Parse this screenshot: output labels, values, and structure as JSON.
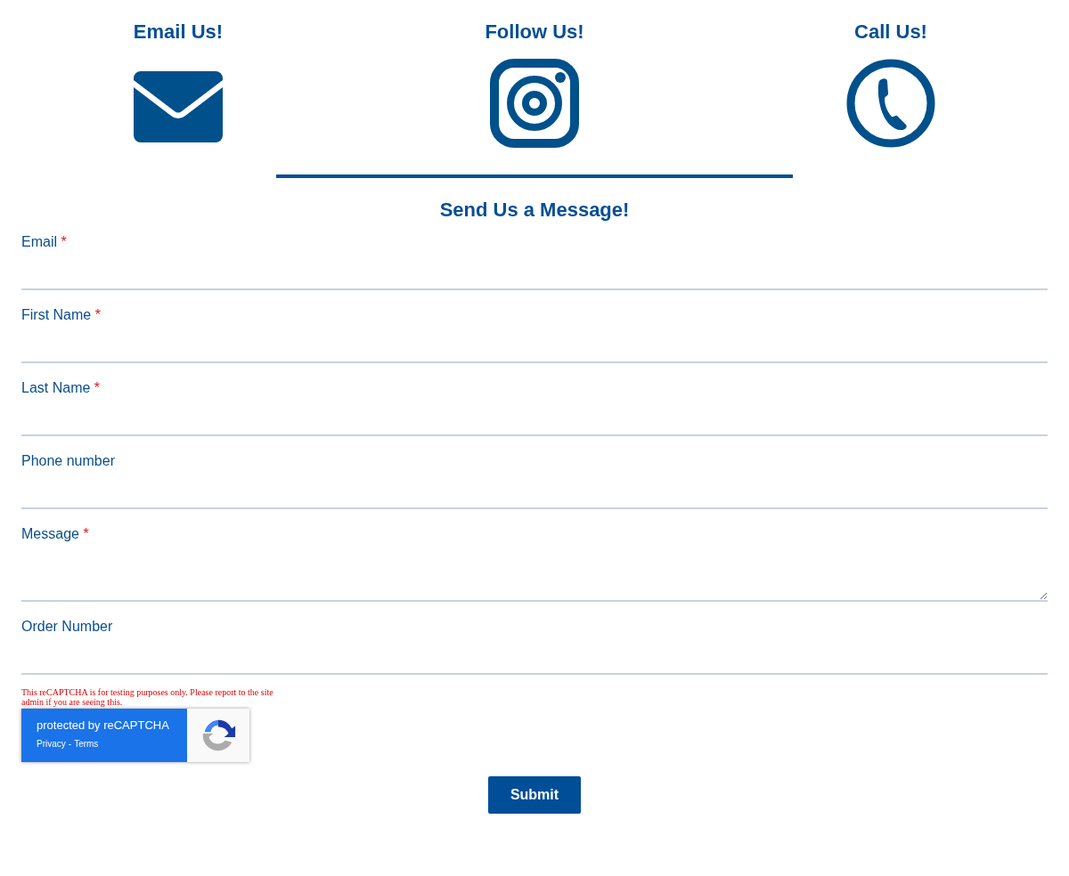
{
  "contacts": [
    {
      "kind": "email",
      "title": "Email Us!"
    },
    {
      "kind": "instagram",
      "title": "Follow Us!"
    },
    {
      "kind": "phone",
      "title": "Call Us!"
    }
  ],
  "form": {
    "title": "Send Us a Message!",
    "required_mark": "*",
    "fields": [
      {
        "kind": "input",
        "label": "Email",
        "required": true
      },
      {
        "kind": "input",
        "label": "First Name",
        "required": true
      },
      {
        "kind": "input",
        "label": "Last Name",
        "required": true
      },
      {
        "kind": "input",
        "label": "Phone number",
        "required": false
      },
      {
        "kind": "textarea",
        "label": "Message",
        "required": true
      },
      {
        "kind": "input",
        "label": "Order Number",
        "required": false
      }
    ],
    "recaptcha": {
      "warning": "This reCAPTCHA is for testing purposes only. Please report to the site admin if you are seeing this.",
      "protected_text": "protected by reCAPTCHA",
      "links": [
        "Privacy",
        "Terms"
      ],
      "separator": "-"
    },
    "submit": "Submit"
  }
}
